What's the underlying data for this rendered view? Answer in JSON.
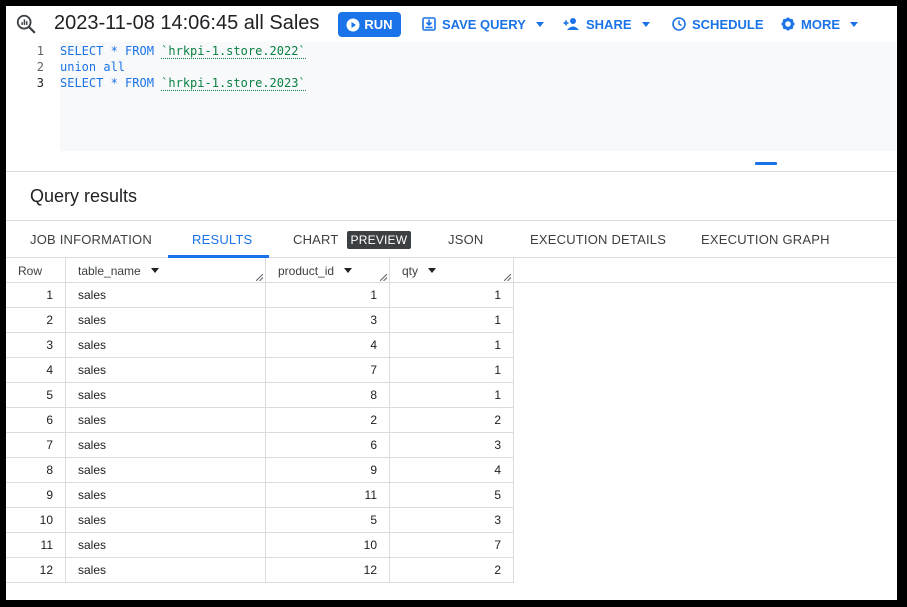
{
  "toolbar": {
    "title": "2023-11-08 14:06:45 all Sales",
    "run_label": "RUN",
    "save_label": "SAVE QUERY",
    "share_label": "SHARE",
    "schedule_label": "SCHEDULE",
    "more_label": "MORE"
  },
  "editor": {
    "line_numbers": [
      "1",
      "2",
      "3"
    ],
    "lines": [
      {
        "kw": "SELECT * FROM ",
        "str": "`hrkpi-1.store.2022`"
      },
      {
        "kw": "union all",
        "str": ""
      },
      {
        "kw": "SELECT * FROM ",
        "str": "`hrkpi-1.store.2023`"
      }
    ]
  },
  "results": {
    "title": "Query results",
    "tabs": [
      "JOB INFORMATION",
      "RESULTS",
      "CHART",
      "JSON",
      "EXECUTION DETAILS",
      "EXECUTION GRAPH"
    ],
    "preview_badge": "PREVIEW",
    "active_tab": "RESULTS"
  },
  "table": {
    "columns": [
      "Row",
      "table_name",
      "product_id",
      "qty"
    ],
    "rows": [
      [
        "1",
        "sales",
        "1",
        "1"
      ],
      [
        "2",
        "sales",
        "3",
        "1"
      ],
      [
        "3",
        "sales",
        "4",
        "1"
      ],
      [
        "4",
        "sales",
        "7",
        "1"
      ],
      [
        "5",
        "sales",
        "8",
        "1"
      ],
      [
        "6",
        "sales",
        "2",
        "2"
      ],
      [
        "7",
        "sales",
        "6",
        "3"
      ],
      [
        "8",
        "sales",
        "9",
        "4"
      ],
      [
        "9",
        "sales",
        "11",
        "5"
      ],
      [
        "10",
        "sales",
        "5",
        "3"
      ],
      [
        "11",
        "sales",
        "10",
        "7"
      ],
      [
        "12",
        "sales",
        "12",
        "2"
      ]
    ]
  },
  "colors": {
    "accent": "#1a73e8",
    "string": "#0b8043"
  }
}
